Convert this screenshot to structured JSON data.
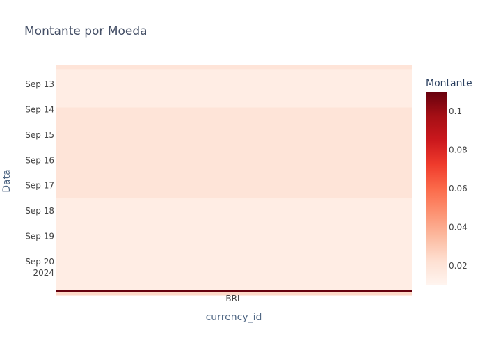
{
  "chart_data": {
    "type": "heatmap",
    "title": "Montante por Moeda",
    "xlabel": "currency_id",
    "ylabel": "Data",
    "x_categories": [
      "BRL"
    ],
    "y_ticks": [
      {
        "date": "2024-09-13",
        "label": "Sep 13"
      },
      {
        "date": "2024-09-14",
        "label": "Sep 14"
      },
      {
        "date": "2024-09-15",
        "label": "Sep 15"
      },
      {
        "date": "2024-09-16",
        "label": "Sep 16"
      },
      {
        "date": "2024-09-17",
        "label": "Sep 17"
      },
      {
        "date": "2024-09-18",
        "label": "Sep 18"
      },
      {
        "date": "2024-09-19",
        "label": "Sep 19"
      },
      {
        "date": "2024-09-20",
        "label": "Sep 20",
        "sublabel": "2024"
      }
    ],
    "cells": [
      {
        "x": "BRL",
        "y_start": "2024-09-12T06:00",
        "y_end": "2024-09-12T10:00",
        "value": 0.02
      },
      {
        "x": "BRL",
        "y_start": "2024-09-12T10:00",
        "y_end": "2024-09-13T22:00",
        "value": 0.015
      },
      {
        "x": "BRL",
        "y_start": "2024-09-13T22:00",
        "y_end": "2024-09-17T12:00",
        "value": 0.02
      },
      {
        "x": "BRL",
        "y_start": "2024-09-17T12:00",
        "y_end": "2024-09-21T03:00",
        "value": 0.015
      },
      {
        "x": "BRL",
        "y_start": "2024-09-21T03:00",
        "y_end": "2024-09-21T05:00",
        "value": 0.11
      },
      {
        "x": "BRL",
        "y_start": "2024-09-21T05:00",
        "y_end": "2024-09-21T08:00",
        "value": 0.025
      }
    ],
    "colorscale": "Reds",
    "colorbar": {
      "title": "Montante",
      "range": [
        0.01,
        0.11
      ],
      "ticks": [
        0.02,
        0.04,
        0.06,
        0.08,
        0.1
      ],
      "tick_labels": [
        "0.02",
        "0.04",
        "0.06",
        "0.08",
        "0.1"
      ],
      "colors": [
        "#fff5f0",
        "#fee0d2",
        "#fcbba1",
        "#fc9272",
        "#fb6a4a",
        "#ef3b2c",
        "#cb181d",
        "#a50f15",
        "#67000d"
      ]
    }
  }
}
